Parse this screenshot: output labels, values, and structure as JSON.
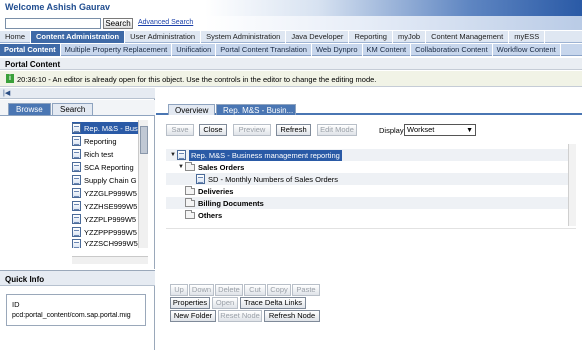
{
  "header": {
    "welcome": "Welcome Ashish Gaurav",
    "search_button": "Search",
    "advanced_search": "Advanced Search"
  },
  "top_nav": [
    {
      "label": "Home",
      "active": false
    },
    {
      "label": "Content Administration",
      "active": true
    },
    {
      "label": "User Administration",
      "active": false
    },
    {
      "label": "System Administration",
      "active": false
    },
    {
      "label": "Java Developer",
      "active": false
    },
    {
      "label": "Reporting",
      "active": false
    },
    {
      "label": "myJob",
      "active": false
    },
    {
      "label": "Content Management",
      "active": false
    },
    {
      "label": "myESS",
      "active": false
    }
  ],
  "sub_nav": [
    {
      "label": "Portal Content",
      "active": true
    },
    {
      "label": "Multiple Property Replacement",
      "active": false
    },
    {
      "label": "Unification",
      "active": false
    },
    {
      "label": "Portal Content Translation",
      "active": false
    },
    {
      "label": "Web Dynpro",
      "active": false
    },
    {
      "label": "KM Content",
      "active": false
    },
    {
      "label": "Collaboration Content",
      "active": false
    },
    {
      "label": "Workflow Content",
      "active": false
    }
  ],
  "page": {
    "title": "Portal Content",
    "message": "20:36:10 - An editor is already open for this object. Use the controls in the editor to change the editing mode."
  },
  "left_panel": {
    "tabs": [
      "Browse",
      "Search"
    ],
    "tree_items": [
      {
        "label": "Rep. M&S - Busi",
        "selected": true
      },
      {
        "label": "Reporting",
        "selected": false
      },
      {
        "label": "Rich test",
        "selected": false
      },
      {
        "label": "SCA Reporting",
        "selected": false
      },
      {
        "label": "Supply Chain G",
        "selected": false
      },
      {
        "label": "YZZGLP999W5",
        "selected": false
      },
      {
        "label": "YZZHSE999W5",
        "selected": false
      },
      {
        "label": "YZZPLP999W5",
        "selected": false
      },
      {
        "label": "YZZPPP999W5",
        "selected": false
      },
      {
        "label": "YZZSCH999W5",
        "selected": false
      }
    ]
  },
  "quick_info": {
    "title": "Quick Info",
    "id_label": "ID",
    "id_value": "pcd:portal_content/com.sap.portal.mig"
  },
  "editor": {
    "tabs": [
      "Overview",
      "Rep. M&S - Busin..."
    ],
    "toolbar": {
      "save": "Save",
      "close": "Close",
      "preview": "Preview",
      "refresh": "Refresh",
      "edit_mode": "Edit Mode",
      "display_label": "Display",
      "display_value": "Workset"
    },
    "tree": {
      "root": "Rep. M&S - Business management reporting",
      "sales_orders": "Sales Orders",
      "sd_item": "SD - Monthly Numbers of Sales Orders",
      "deliveries": "Deliveries",
      "billing": "Billing Documents",
      "others": "Others"
    },
    "lower_buttons": {
      "up": "Up",
      "down": "Down",
      "delete": "Delete",
      "cut": "Cut",
      "copy": "Copy",
      "paste": "Paste",
      "properties": "Properties",
      "open": "Open",
      "trace_delta_links": "Trace Delta Links",
      "new_folder": "New Folder",
      "reset_node": "Reset Node",
      "refresh_node": "Refresh Node"
    }
  }
}
